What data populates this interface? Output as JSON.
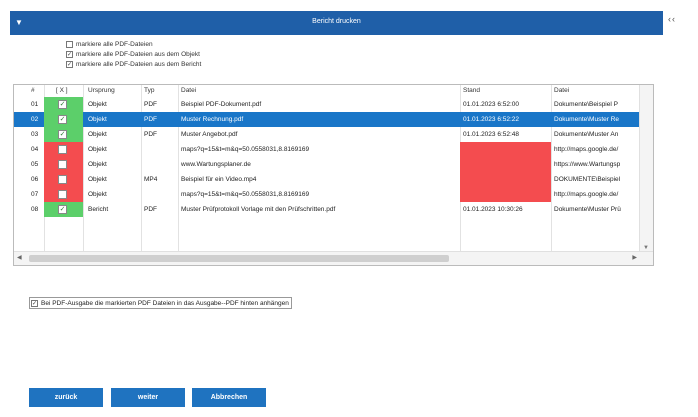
{
  "window": {
    "title": "Bericht drucken",
    "menu_icon": "menu-icon",
    "collapse_icon": "double-chevron-left-icon"
  },
  "options": [
    {
      "label": "markiere alle PDF-Dateien",
      "checked": false
    },
    {
      "label": "markiere alle PDF-Dateien aus dem Objekt",
      "checked": true
    },
    {
      "label": "markiere alle PDF-Dateien aus dem Bericht",
      "checked": true
    }
  ],
  "table": {
    "columns": [
      "#",
      "[ X ]",
      "Ursprung",
      "Typ",
      "Datei",
      "Stand",
      "Datei"
    ],
    "rows": [
      {
        "num": "01",
        "checked": true,
        "status": "green",
        "origin": "Objekt",
        "type": "PDF",
        "file": "Beispiel PDF-Dokument.pdf",
        "date": "01.01.2023  6:52:00",
        "path": "Dokumente\\Beispiel P"
      },
      {
        "num": "02",
        "checked": true,
        "status": "green",
        "origin": "Objekt",
        "type": "PDF",
        "file": "Muster Rechnung.pdf",
        "date": "01.01.2023  6:52:22",
        "path": "Dokumente\\Muster Re",
        "selected": true
      },
      {
        "num": "03",
        "checked": true,
        "status": "green",
        "origin": "Objekt",
        "type": "PDF",
        "file": "Muster Angebot.pdf",
        "date": "01.01.2023  6:52:48",
        "path": "Dokumente\\Muster An"
      },
      {
        "num": "04",
        "checked": false,
        "status": "red",
        "origin": "Objekt",
        "type": "",
        "file": "maps?q=15&t=m&q=50.0558031,8.8169169",
        "date": "",
        "path": "http://maps.google.de/"
      },
      {
        "num": "05",
        "checked": false,
        "status": "red",
        "origin": "Objekt",
        "type": "",
        "file": "www.Wartungsplaner.de",
        "date": "",
        "path": "https://www.Wartungsp"
      },
      {
        "num": "06",
        "checked": false,
        "status": "red",
        "origin": "Objekt",
        "type": "MP4",
        "file": "Beispiel für ein Video.mp4",
        "date": "",
        "path": "DOKUMENTE\\Beispiel"
      },
      {
        "num": "07",
        "checked": false,
        "status": "red",
        "origin": "Objekt",
        "type": "",
        "file": "maps?q=15&t=m&q=50.0558031,8.8169169",
        "date": "",
        "path": "http://maps.google.de/"
      },
      {
        "num": "08",
        "checked": true,
        "status": "green",
        "origin": "Bericht",
        "type": "PDF",
        "file": "Muster Prüfprotokoll Vorlage mit den Prüfschritten.pdf",
        "date": "01.01.2023  10:30:26",
        "path": "Dokumente\\Muster Prü"
      }
    ]
  },
  "append_option": {
    "label": "Bei PDF-Ausgabe die markierten PDF Dateien in das Ausgabe--PDF hinten anhängen",
    "checked": true
  },
  "buttons": {
    "back": "zurück",
    "next": "weiter",
    "cancel": "Abbrechen"
  },
  "colors": {
    "accent": "#1f5fa8",
    "selection": "#1976c8",
    "ok": "#5ccf6a",
    "error": "#f44c4f",
    "button": "#1f73c0"
  }
}
